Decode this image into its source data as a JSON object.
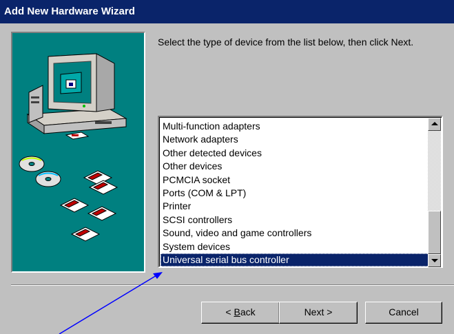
{
  "window": {
    "title": "Add New Hardware Wizard"
  },
  "instruction": "Select the type of device from the list below, then click Next.",
  "device_list": {
    "items": [
      "Multi-function adapters",
      "Network adapters",
      "Other detected devices",
      "Other devices",
      "PCMCIA socket",
      "Ports (COM & LPT)",
      "Printer",
      "SCSI controllers",
      "Sound, video and game controllers",
      "System devices",
      "Universal serial bus controller"
    ],
    "selected_index": 10
  },
  "buttons": {
    "back_prefix": "< ",
    "back_mnemonic": "B",
    "back_rest": "ack",
    "next": "Next >",
    "cancel": "Cancel"
  },
  "icons": {
    "scroll_up": "scroll-up-arrow-icon",
    "scroll_down": "scroll-down-arrow-icon",
    "artwork": "computer-with-disks-illustration"
  },
  "colors": {
    "titlebar": "#0a246a",
    "face": "#c0c0c0",
    "artwork_bg": "#008080",
    "selection": "#0a246a",
    "annotation_arrow": "#0000ff"
  }
}
